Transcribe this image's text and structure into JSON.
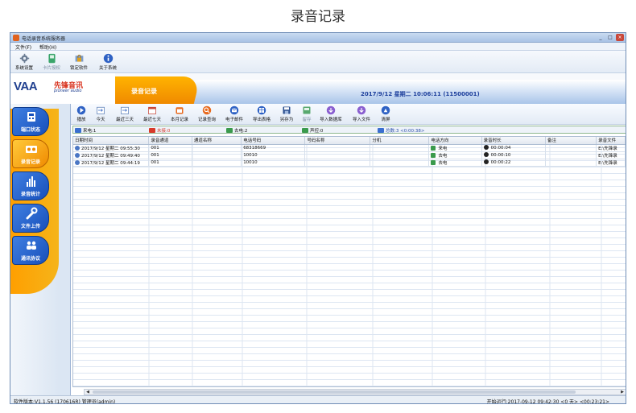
{
  "page_title": "录音记录",
  "window": {
    "title": "电话录音系统服务器",
    "controls": [
      "_",
      "□",
      "×"
    ]
  },
  "menu": [
    {
      "label": "文件(F)"
    },
    {
      "label": "帮助(H)"
    }
  ],
  "toolbar": [
    {
      "label": "系统设置",
      "icon": "gear-icon",
      "enabled": true
    },
    {
      "label": "卡片授权",
      "icon": "card-icon",
      "enabled": false
    },
    {
      "label": "锁定软件",
      "icon": "lock-icon",
      "enabled": true
    },
    {
      "label": "关于系统",
      "icon": "info-icon",
      "enabled": true
    }
  ],
  "banner": {
    "logo_text": "VAA",
    "brand_cn": "先锋音讯",
    "brand_en": "pioneer audio",
    "section_tab": "录音记录",
    "datetime": "2017/9/12 星期二  10:06:11 (11500001)"
  },
  "sidebar": [
    {
      "label": "端口状态",
      "icon": "phone-icon",
      "active": false
    },
    {
      "label": "录音记录",
      "icon": "cassette-icon",
      "active": true
    },
    {
      "label": "录音统计",
      "icon": "bar-chart-icon",
      "active": false
    },
    {
      "label": "文件上传",
      "icon": "wrench-icon",
      "active": false
    },
    {
      "label": "通讯协议",
      "icon": "people-icon",
      "active": false
    }
  ],
  "actions": [
    {
      "label": "播放",
      "icon": "play-icon",
      "enabled": true
    },
    {
      "label": "今天",
      "icon": "today-icon",
      "enabled": true
    },
    {
      "label": "最近三天",
      "icon": "three-days-icon",
      "enabled": true
    },
    {
      "label": "最近七天",
      "icon": "seven-days-icon",
      "enabled": true
    },
    {
      "label": "本月记录",
      "icon": "month-icon",
      "enabled": true
    },
    {
      "label": "记录查询",
      "icon": "query-icon",
      "enabled": true
    },
    {
      "label": "电子邮件",
      "icon": "email-icon",
      "enabled": true
    },
    {
      "label": "导出表格",
      "icon": "export-table-icon",
      "enabled": true
    },
    {
      "label": "另存为",
      "icon": "save-as-icon",
      "enabled": true
    },
    {
      "label": "留存",
      "icon": "archive-icon",
      "enabled": false
    },
    {
      "label": "导入数据库",
      "icon": "import-db-icon",
      "enabled": true
    },
    {
      "label": "导入文件",
      "icon": "import-file-icon",
      "enabled": true
    },
    {
      "label": "清屏",
      "icon": "clear-icon",
      "enabled": true
    }
  ],
  "status_strip": [
    {
      "label": "来电:1",
      "color": "#3a6fd0"
    },
    {
      "label": "未接:0",
      "color": "#d83a2a"
    },
    {
      "label": "去电:2",
      "color": "#3a9a4c"
    },
    {
      "label": "声控:0",
      "color": "#3a9a4c"
    },
    {
      "label": "总数:3 <0:00:38>",
      "color": "#3a6fd0"
    }
  ],
  "table": {
    "columns": [
      "日期时间",
      "录音通道",
      "通道名称",
      "电话号码",
      "号码名称",
      "分机",
      "电话方向",
      "录音时长",
      "备注",
      "录音文件"
    ],
    "rows": [
      {
        "datetime": "2017/9/12 星期二 09:55:30",
        "channel": "001",
        "channel_name": "",
        "number": "68318669",
        "number_name": "",
        "extension": "",
        "direction": "来电",
        "duration": "00:00:04",
        "note": "",
        "file": "E:\\先锋录"
      },
      {
        "datetime": "2017/9/12 星期二 09:49:40",
        "channel": "001",
        "channel_name": "",
        "number": "10010",
        "number_name": "",
        "extension": "",
        "direction": "去电",
        "duration": "00:00:10",
        "note": "",
        "file": "E:\\先锋录"
      },
      {
        "datetime": "2017/9/12 星期二 09:44:19",
        "channel": "001",
        "channel_name": "",
        "number": "10010",
        "number_name": "",
        "extension": "",
        "direction": "去电",
        "duration": "00:00:22",
        "note": "",
        "file": "E:\\先锋录"
      }
    ]
  },
  "statusbar": {
    "left": "软件版本:V1.1.56 (170616R)  管理员(admin)",
    "right": "开始运行:2017-09-12 09:42:30  <0 天> <00:23:21>"
  }
}
